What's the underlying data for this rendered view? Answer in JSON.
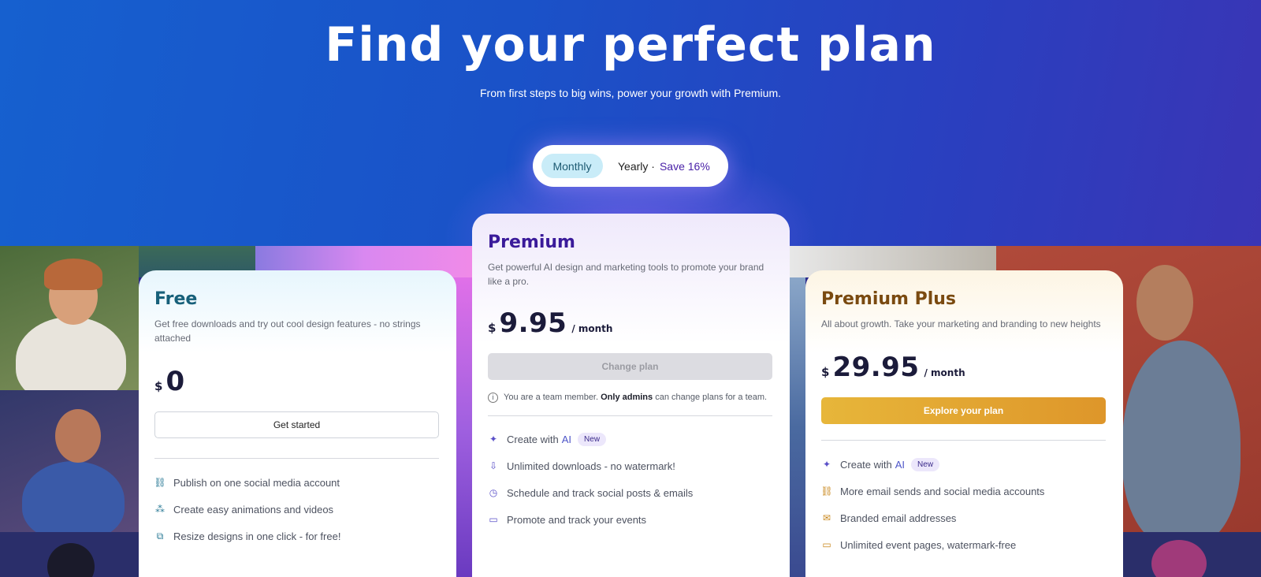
{
  "hero": {
    "title": "Find your perfect plan",
    "subtitle": "From first steps to big wins, power your growth with Premium."
  },
  "billing_toggle": {
    "monthly": "Monthly",
    "yearly": "Yearly ·",
    "save": "Save 16%"
  },
  "plans": [
    {
      "name": "Free",
      "description": "Get free downloads and try out cool design features - no strings attached",
      "currency": "$",
      "price": "0",
      "button": "Get started",
      "features": [
        {
          "icon": "share-icon",
          "text": "Publish on one social media account"
        },
        {
          "icon": "animation-icon",
          "text": "Create easy animations and videos"
        },
        {
          "icon": "resize-icon",
          "text": "Resize designs in one click - for free!"
        }
      ]
    },
    {
      "name": "Premium",
      "description": "Get powerful AI design and marketing tools to promote your brand like a pro.",
      "currency": "$",
      "price": "9.95",
      "period": "/ month",
      "button": "Change plan",
      "note_pre": "You are a team member.",
      "note_bold": "Only admins",
      "note_post": "can change plans for a team.",
      "features": [
        {
          "icon": "sparkle-icon",
          "text": "Create with",
          "ai": "AI",
          "badge": "New"
        },
        {
          "icon": "download-icon",
          "text": "Unlimited downloads - no watermark!"
        },
        {
          "icon": "clock-icon",
          "text": "Schedule and track social posts & emails"
        },
        {
          "icon": "ticket-icon",
          "text": "Promote and track your events"
        }
      ]
    },
    {
      "name": "Premium Plus",
      "description": "All about growth. Take your marketing and branding to new heights",
      "currency": "$",
      "price": "29.95",
      "period": "/ month",
      "button": "Explore your plan",
      "features": [
        {
          "icon": "sparkle-icon",
          "text": "Create with",
          "ai": "AI",
          "badge": "New"
        },
        {
          "icon": "share-icon",
          "text": "More email sends and social media accounts"
        },
        {
          "icon": "mail-icon",
          "text": "Branded email addresses"
        },
        {
          "icon": "ticket-icon",
          "text": "Unlimited event pages, watermark-free"
        }
      ]
    }
  ]
}
